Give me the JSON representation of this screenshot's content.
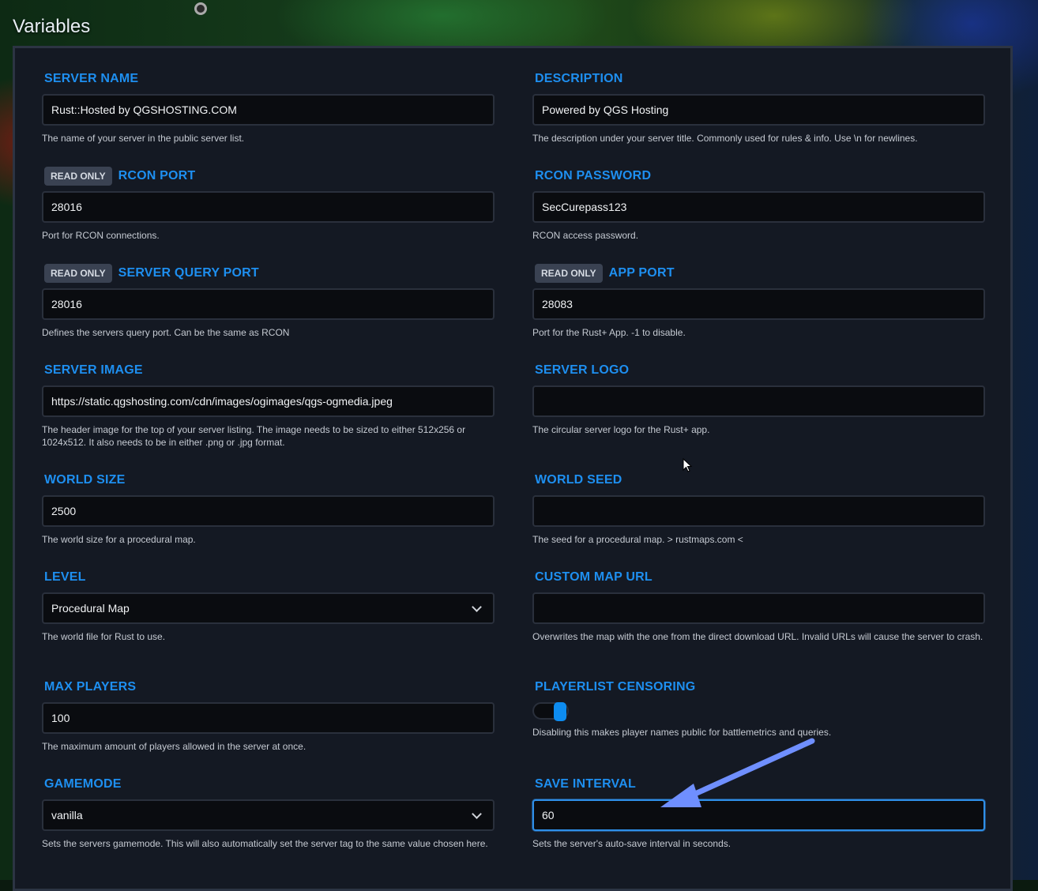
{
  "page": {
    "title": "Variables"
  },
  "badges": {
    "read_only": "READ ONLY"
  },
  "fields": {
    "server_name": {
      "label": "SERVER NAME",
      "value": "Rust::Hosted by QGSHOSTING.COM",
      "help": "The name of your server in the public server list."
    },
    "description": {
      "label": "DESCRIPTION",
      "value": "Powered by QGS Hosting",
      "help": "The description under your server title. Commonly used for rules & info. Use \\n for newlines."
    },
    "rcon_port": {
      "label": "RCON PORT",
      "value": "28016",
      "help": "Port for RCON connections."
    },
    "rcon_password": {
      "label": "RCON PASSWORD",
      "value": "SecCurepass123",
      "help": "RCON access password."
    },
    "server_query_port": {
      "label": "SERVER QUERY PORT",
      "value": "28016",
      "help": "Defines the servers query port. Can be the same as RCON"
    },
    "app_port": {
      "label": "APP PORT",
      "value": "28083",
      "help": "Port for the Rust+ App. -1 to disable."
    },
    "server_image": {
      "label": "SERVER IMAGE",
      "value": "https://static.qgshosting.com/cdn/images/ogimages/qgs-ogmedia.jpeg",
      "help": "The header image for the top of your server listing. The image needs to be sized to either 512x256 or 1024x512. It also needs to be in either .png or .jpg format."
    },
    "server_logo": {
      "label": "SERVER LOGO",
      "value": "",
      "help": "The circular server logo for the Rust+ app."
    },
    "world_size": {
      "label": "WORLD SIZE",
      "value": "2500",
      "help": "The world size for a procedural map."
    },
    "world_seed": {
      "label": "WORLD SEED",
      "value": "",
      "help": "The seed for a procedural map. > rustmaps.com <"
    },
    "level": {
      "label": "LEVEL",
      "value": "Procedural Map",
      "help": "The world file for Rust to use."
    },
    "custom_map_url": {
      "label": "CUSTOM MAP URL",
      "value": "",
      "help": "Overwrites the map with the one from the direct download URL. Invalid URLs will cause the server to crash."
    },
    "max_players": {
      "label": "MAX PLAYERS",
      "value": "100",
      "help": "The maximum amount of players allowed in the server at once."
    },
    "playerlist_censoring": {
      "label": "PLAYERLIST CENSORING",
      "enabled": true,
      "help": "Disabling this makes player names public for battlemetrics and queries."
    },
    "gamemode": {
      "label": "GAMEMODE",
      "value": "vanilla",
      "help": "Sets the servers gamemode. This will also automatically set the server tag to the same value chosen here."
    },
    "save_interval": {
      "label": "SAVE INTERVAL",
      "value": "60",
      "help": "Sets the server's auto-save interval in seconds."
    }
  },
  "colors": {
    "accent": "#1e8ff0",
    "panel": "#141923",
    "input_bg": "#0a0c10",
    "annotation_arrow": "#6f8fff"
  }
}
